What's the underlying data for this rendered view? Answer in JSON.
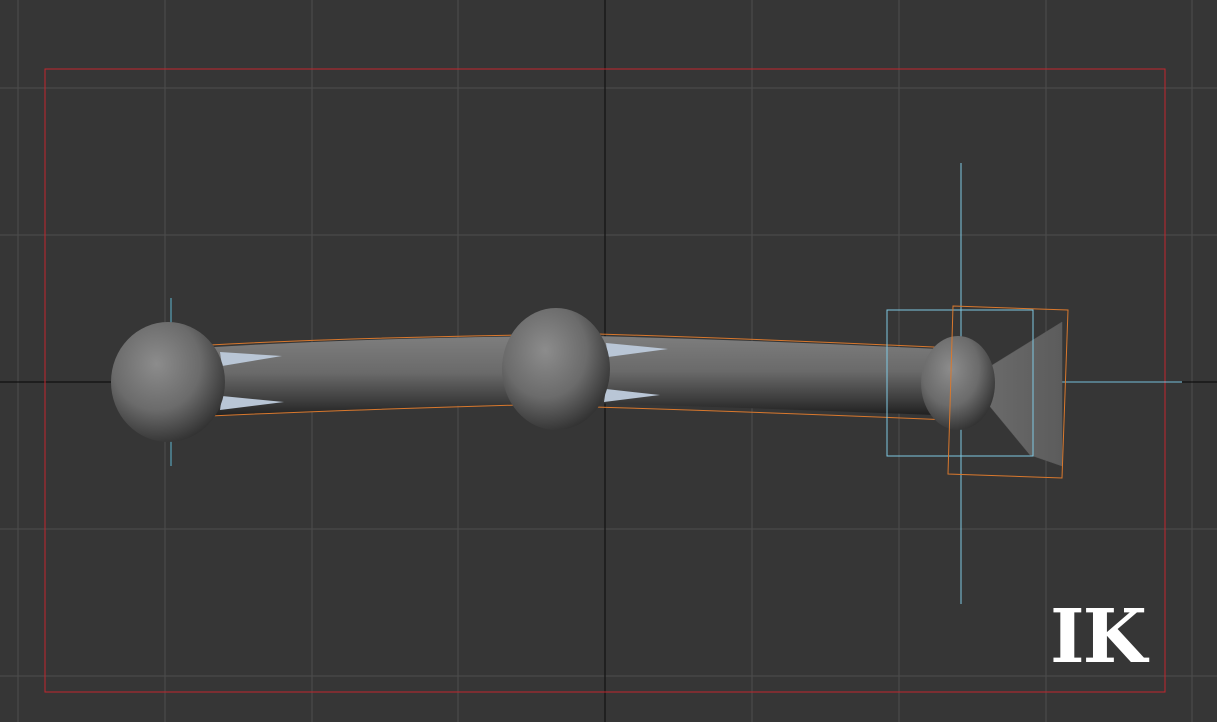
{
  "viewport": {
    "mode_label": "IK"
  },
  "colors": {
    "background": "#363636",
    "grid_line": "#4d4d4d",
    "origin_axis": "#111111",
    "safe_frame": "#c1272d",
    "selection_bounds": "#d9782d",
    "ik_handle": "#7ec8e3",
    "joint_shading_light": "#8a8a8a",
    "joint_shading_dark": "#3a3a3a",
    "bone_fin": "#b9c6d6"
  },
  "scene": {
    "bones": [
      "bone-upper",
      "bone-lower"
    ],
    "joints": [
      "joint-root",
      "joint-middle",
      "joint-end"
    ],
    "end_effector": "cone-end-effector"
  }
}
